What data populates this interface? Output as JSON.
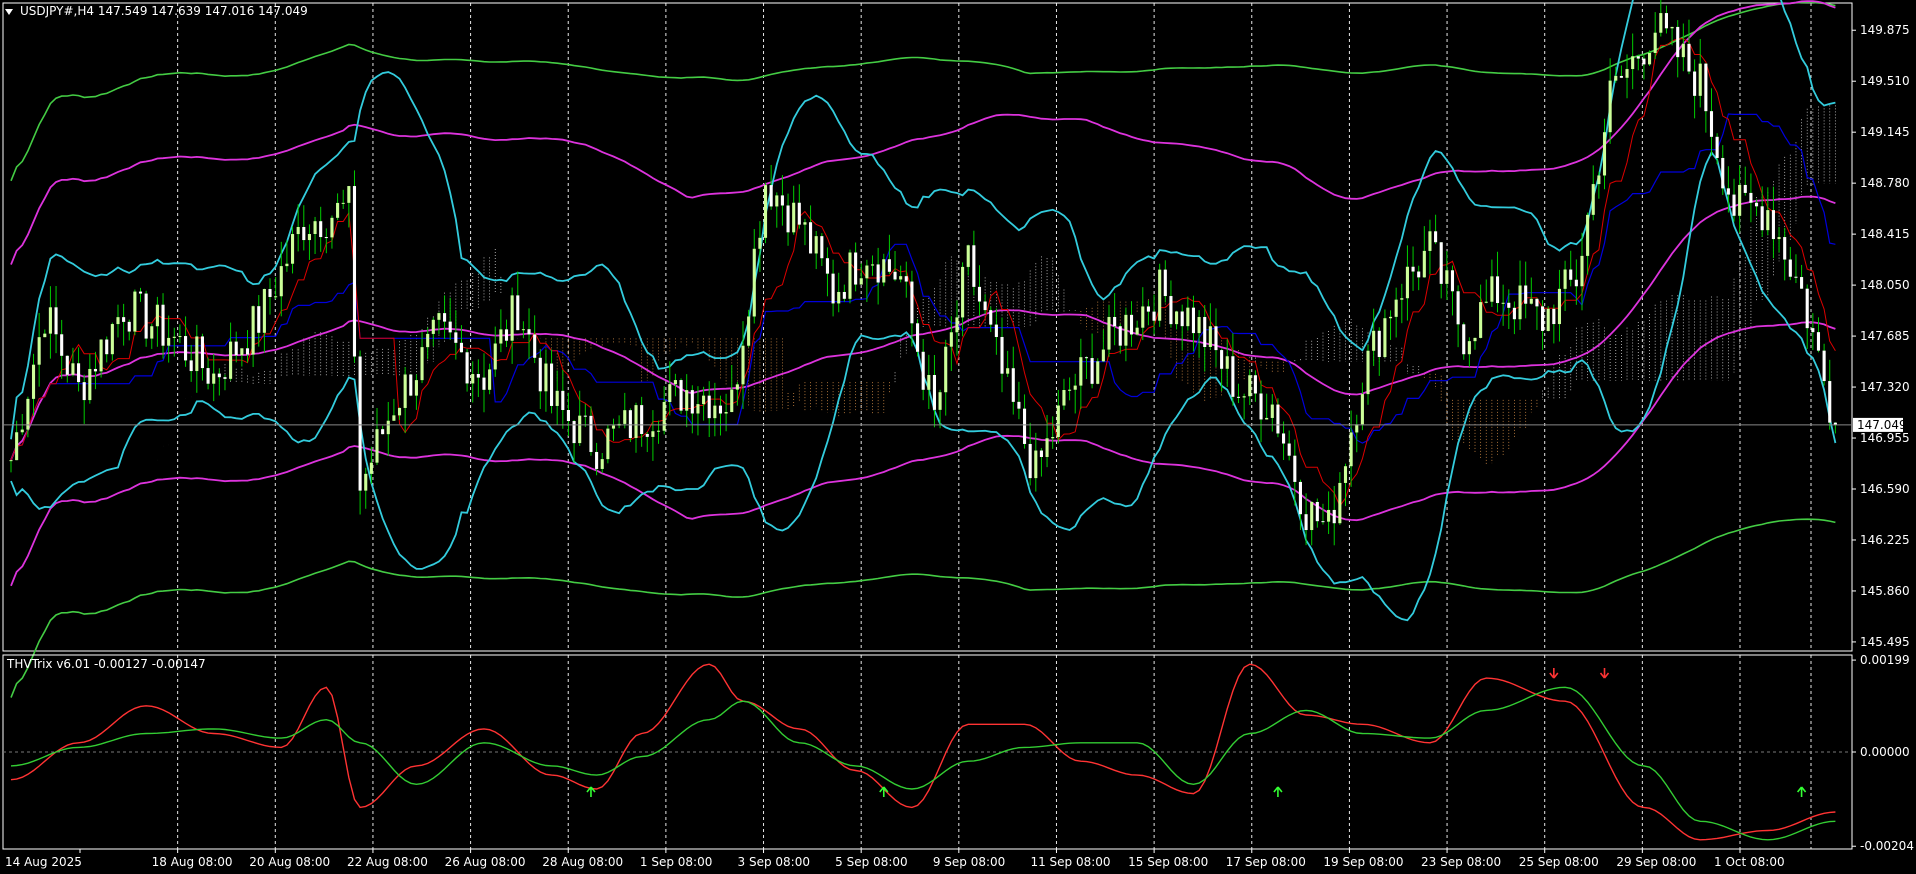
{
  "window": {
    "symbol_line": "USDJPY#,H4  147.549 147.639 147.016 147.049",
    "indicator_line": "THVTrix v6.01 -0.00127 -0.00147",
    "current_price_label": "147.049"
  },
  "colors": {
    "background": "#000000",
    "axis": "#ffffff",
    "grid": "#ffffff",
    "bull_candle": "#ccff99",
    "bear_candle": "#ffffff",
    "wick": "#00cc00",
    "bollinger_cyan": "#33ccdd",
    "envelope_magenta": "#dd33dd",
    "envelope_green": "#44cc44",
    "kijun_blue": "#0000dd",
    "tenkan_red": "#dd0000",
    "cloud_bull": "#cccccc",
    "cloud_bear": "#cc8844",
    "trix_red": "#ff3333",
    "trix_green": "#33cc33",
    "price_tag_bg": "#ffffff"
  },
  "chart_data": [
    {
      "type": "candlestick",
      "title": "USDJPY#,H4  147.549 147.639 147.016 147.049",
      "y_ticks": [
        "149.875",
        "149.510",
        "149.145",
        "148.780",
        "148.415",
        "148.050",
        "147.685",
        "147.320",
        "146.955",
        "146.590",
        "146.225",
        "145.860",
        "145.495"
      ],
      "ylim": [
        145.43,
        150.07
      ],
      "x_ticks": [
        "14 Aug 2025",
        "18 Aug 08:00",
        "20 Aug 08:00",
        "22 Aug 08:00",
        "26 Aug 08:00",
        "28 Aug 08:00",
        "1 Sep 08:00",
        "3 Sep 08:00",
        "5 Sep 08:00",
        "9 Sep 08:00",
        "11 Sep 08:00",
        "15 Sep 08:00",
        "17 Sep 08:00",
        "19 Sep 08:00",
        "23 Sep 08:00",
        "25 Sep 08:00",
        "29 Sep 08:00",
        "1 Oct 08:00"
      ],
      "last_close": 147.049,
      "close_path": [
        [
          0,
          146.8
        ],
        [
          6,
          147.85
        ],
        [
          12,
          147.3
        ],
        [
          20,
          147.9
        ],
        [
          28,
          147.7
        ],
        [
          36,
          147.4
        ],
        [
          44,
          147.8
        ],
        [
          52,
          148.5
        ],
        [
          60,
          148.6
        ],
        [
          62,
          146.6
        ],
        [
          68,
          147.2
        ],
        [
          76,
          147.7
        ],
        [
          84,
          147.4
        ],
        [
          90,
          147.9
        ],
        [
          96,
          147.2
        ],
        [
          104,
          146.9
        ],
        [
          112,
          147.1
        ],
        [
          120,
          147.3
        ],
        [
          128,
          147.2
        ],
        [
          134,
          148.8
        ],
        [
          140,
          148.5
        ],
        [
          146,
          148.0
        ],
        [
          152,
          148.3
        ],
        [
          158,
          148.1
        ],
        [
          164,
          147.1
        ],
        [
          170,
          148.2
        ],
        [
          176,
          147.4
        ],
        [
          182,
          146.7
        ],
        [
          188,
          147.3
        ],
        [
          196,
          147.7
        ],
        [
          204,
          148.0
        ],
        [
          210,
          147.8
        ],
        [
          218,
          147.3
        ],
        [
          224,
          147.2
        ],
        [
          230,
          146.45
        ],
        [
          234,
          146.3
        ],
        [
          240,
          147.4
        ],
        [
          246,
          148.0
        ],
        [
          252,
          148.3
        ],
        [
          258,
          147.7
        ],
        [
          264,
          148.0
        ],
        [
          272,
          147.8
        ],
        [
          278,
          148.1
        ],
        [
          284,
          149.4
        ],
        [
          292,
          149.9
        ],
        [
          300,
          149.5
        ],
        [
          306,
          148.6
        ],
        [
          312,
          148.6
        ],
        [
          318,
          148.0
        ],
        [
          324,
          147.049
        ]
      ]
    },
    {
      "type": "line",
      "title": "THVTrix v6.01 -0.00127 -0.00147",
      "y_ticks": [
        "0.00199",
        "0.00000",
        "-0.00204"
      ],
      "ylim": [
        -0.0021,
        0.0021
      ],
      "series": [
        {
          "color": "#ff3333",
          "x": [
            0,
            12,
            24,
            36,
            48,
            56,
            62,
            72,
            84,
            96,
            104,
            112,
            124,
            130,
            140,
            150,
            160,
            170,
            180,
            190,
            200,
            210,
            220,
            230,
            240,
            252,
            262,
            276,
            290,
            300,
            312,
            324
          ],
          "values": [
            -0.0006,
            0.0002,
            0.001,
            0.0004,
            0.0001,
            0.0014,
            -0.0012,
            -0.0003,
            0.0005,
            -0.0005,
            -0.0008,
            0.0004,
            0.0019,
            0.0011,
            0.0005,
            -0.0004,
            -0.0012,
            0.0006,
            0.0006,
            -0.0002,
            -0.0005,
            -0.0009,
            0.0019,
            0.0008,
            0.0006,
            0.0002,
            0.0016,
            0.0011,
            -0.0012,
            -0.0019,
            -0.0017,
            -0.0013
          ]
        },
        {
          "color": "#33cc33",
          "x": [
            0,
            12,
            24,
            36,
            48,
            56,
            62,
            72,
            84,
            96,
            104,
            112,
            124,
            130,
            140,
            150,
            160,
            170,
            180,
            190,
            200,
            210,
            220,
            230,
            240,
            252,
            262,
            276,
            290,
            300,
            312,
            324
          ],
          "values": [
            -0.0003,
            0.0001,
            0.0004,
            0.0005,
            0.0003,
            0.0007,
            0.0002,
            -0.0007,
            0.0002,
            -0.0003,
            -0.0005,
            -0.0001,
            0.0007,
            0.0011,
            0.0002,
            -0.0003,
            -0.0008,
            -0.0002,
            0.0001,
            0.0002,
            0.0002,
            -0.0007,
            0.0004,
            0.0009,
            0.0004,
            0.0003,
            0.0009,
            0.0014,
            -0.0003,
            -0.0015,
            -0.0019,
            -0.0015
          ]
        }
      ],
      "up_arrows_at": [
        103,
        155,
        225,
        318
      ],
      "down_arrows_at": [
        274,
        283
      ]
    }
  ]
}
